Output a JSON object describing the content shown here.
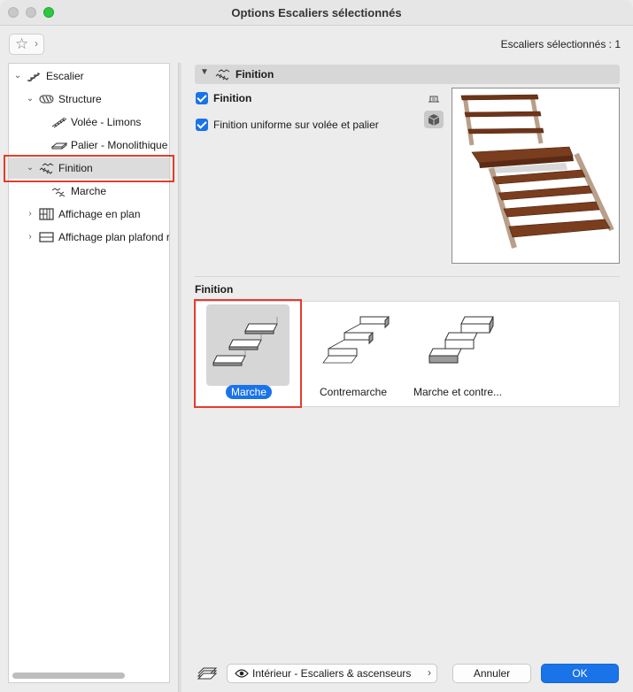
{
  "window": {
    "title": "Options Escaliers sélectionnés"
  },
  "toolbar": {
    "selection_count": "Escaliers sélectionnés : 1"
  },
  "tree": {
    "items": [
      {
        "label": "Escalier",
        "expanded": true
      },
      {
        "label": "Structure",
        "expanded": true
      },
      {
        "label": "Volée - Limons"
      },
      {
        "label": "Palier - Monolithique"
      },
      {
        "label": "Finition",
        "expanded": true,
        "selected": true
      },
      {
        "label": "Marche"
      },
      {
        "label": "Affichage en plan",
        "expanded": false
      },
      {
        "label": "Affichage plan plafond r",
        "expanded": false
      }
    ]
  },
  "panel": {
    "section_title": "Finition",
    "checkbox_finition": {
      "label": "Finition",
      "checked": true
    },
    "checkbox_uniform": {
      "label": "Finition uniforme sur volée et palier",
      "checked": true
    },
    "subsection_label": "Finition",
    "options": [
      {
        "label": "Marche",
        "selected": true
      },
      {
        "label": "Contremarche",
        "selected": false
      },
      {
        "label": "Marche et contre...",
        "selected": false
      }
    ]
  },
  "footer": {
    "favorites_label": "Intérieur - Escaliers & ascenseurs",
    "cancel_label": "Annuler",
    "ok_label": "OK"
  },
  "colors": {
    "accent": "#1a73e8",
    "highlight_border": "#e53b2c",
    "wood": "#7a3d1e"
  }
}
